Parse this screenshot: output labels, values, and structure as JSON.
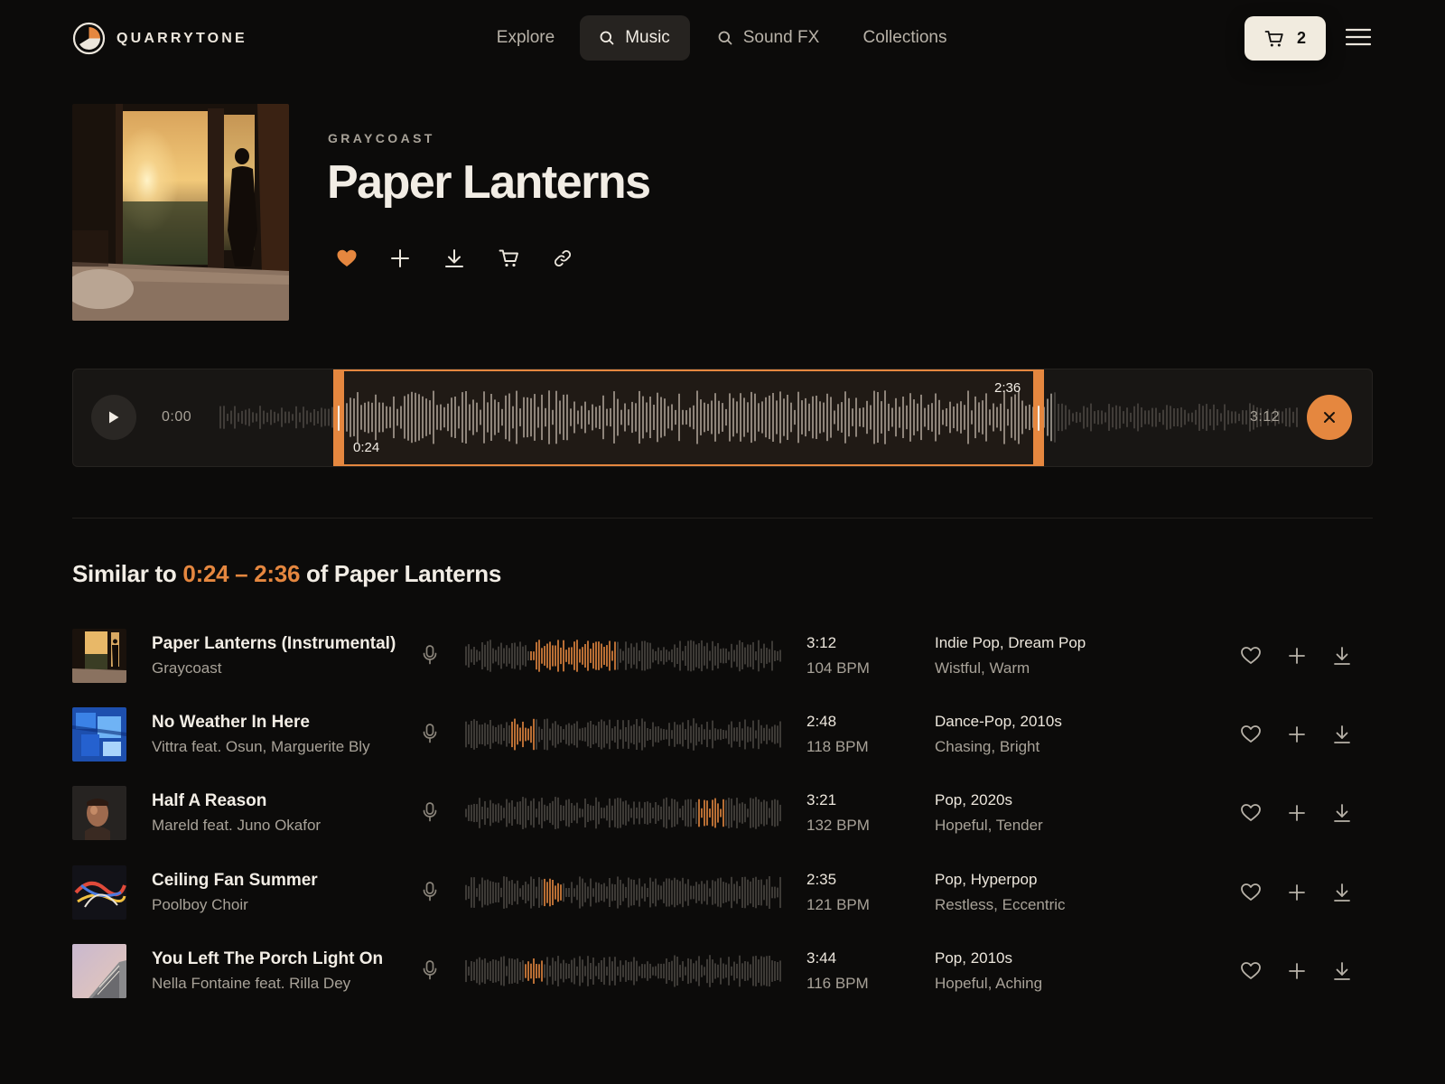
{
  "brand": {
    "name": "QUARRYTONE"
  },
  "nav": {
    "items": [
      {
        "label": "Explore",
        "icon": "",
        "active": false
      },
      {
        "label": "Music",
        "icon": "search-icon",
        "active": true
      },
      {
        "label": "Sound FX",
        "icon": "search-icon",
        "active": false
      },
      {
        "label": "Collections",
        "icon": "",
        "active": false
      }
    ]
  },
  "cart": {
    "count": "2",
    "icon": "cart-icon"
  },
  "menu": {
    "icon": "hamburger-menu-icon"
  },
  "track": {
    "artist": "GRAYCOAST",
    "title": "Paper Lanterns",
    "favorited": true,
    "actions": [
      "heart-icon",
      "plus-icon",
      "download-icon",
      "cart-icon",
      "link-icon"
    ]
  },
  "player": {
    "current_time": "0:00",
    "duration": "3:12",
    "selection_start": "0:24",
    "selection_end": "2:36",
    "accent_color": "#e5873f"
  },
  "similar": {
    "prefix": "Similar to",
    "range": "0:24 – 2:36",
    "suffix": "of Paper Lanterns",
    "rows": [
      {
        "title": "Paper Lanterns (Instrumental)",
        "artist": "Graycoast",
        "duration": "3:12",
        "bpm": "104 BPM",
        "genres": "Indie Pop, Dream Pop",
        "moods": "Wistful, Warm"
      },
      {
        "title": "No Weather In Here",
        "artist": "Vittra feat. Osun, Marguerite Bly",
        "duration": "2:48",
        "bpm": "118 BPM",
        "genres": "Dance-Pop, 2010s",
        "moods": "Chasing, Bright"
      },
      {
        "title": "Half A Reason",
        "artist": "Mareld feat. Juno Okafor",
        "duration": "3:21",
        "bpm": "132 BPM",
        "genres": "Pop, 2020s",
        "moods": "Hopeful, Tender"
      },
      {
        "title": "Ceiling Fan Summer",
        "artist": "Poolboy Choir",
        "duration": "2:35",
        "bpm": "121 BPM",
        "genres": "Pop, Hyperpop",
        "moods": "Restless, Eccentric"
      },
      {
        "title": "You Left The Porch Light On",
        "artist": "Nella Fontaine feat. Rilla Dey",
        "duration": "3:44",
        "bpm": "116 BPM",
        "genres": "Pop, 2010s",
        "moods": "Hopeful, Aching"
      }
    ]
  }
}
